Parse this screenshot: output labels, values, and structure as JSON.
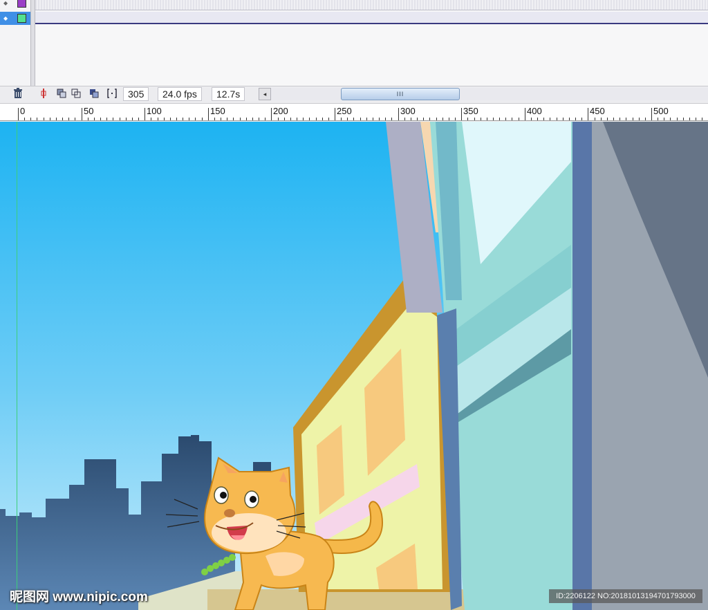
{
  "timeline": {
    "layers": [
      {
        "color": "#9a3fc7",
        "selected": false
      },
      {
        "color": "#52e08f",
        "selected": true
      }
    ]
  },
  "status": {
    "current_frame": "305",
    "frame_rate": "24.0 fps",
    "elapsed_time": "12.7s",
    "scroll_left_glyph": "◂",
    "scroll_thumb_grip": "III"
  },
  "ruler": {
    "labels": [
      "0",
      "50",
      "100",
      "150",
      "200",
      "250",
      "300",
      "350",
      "400",
      "450",
      "500"
    ]
  },
  "icons": [
    "trash-icon",
    "onion-skin-icon",
    "onion-skin-outline-icon",
    "edit-multiple-frames-icon",
    "modify-onion-markers-icon",
    "scroll-left-icon"
  ],
  "watermark": {
    "site": "昵图网 www.nipic.com",
    "id": "ID:2206122 NO:20181013194701793000"
  }
}
